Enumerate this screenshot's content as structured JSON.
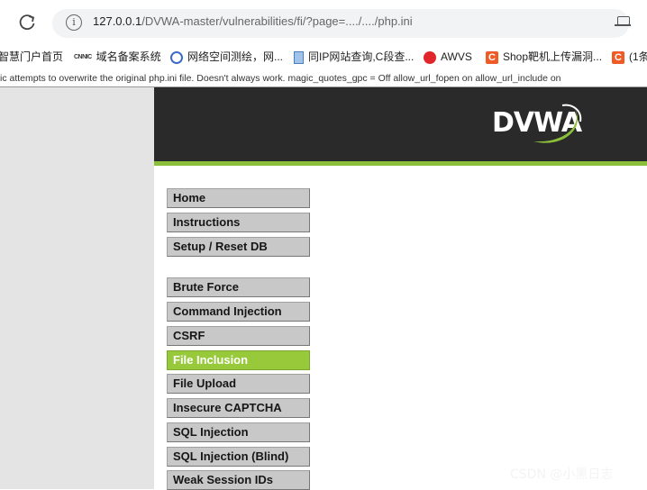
{
  "browser": {
    "url_host": "127.0.0.1",
    "url_path": "/DVWA-master/vulnerabilities/fi/?page=..../..../php.ini",
    "reload_icon": "reload-icon",
    "site_info_icon": "info-icon",
    "tab_icon": "tab-search-icon"
  },
  "bookmarks": [
    {
      "label": "智慧门户首页",
      "icon": "none"
    },
    {
      "label": "域名备案系统",
      "icon": "cnnic-icon",
      "icon_text": "CNNIC"
    },
    {
      "label": "网络空间测绘，网...",
      "icon": "globe-icon"
    },
    {
      "label": "同IP网站查询,C段查...",
      "icon": "document-icon"
    },
    {
      "label": "AWVS",
      "icon": "awvs-icon"
    },
    {
      "label": "Shop靶机上传漏洞...",
      "icon": "csdn-icon",
      "icon_text": "C"
    },
    {
      "label": "(1条",
      "icon": "csdn-icon",
      "icon_text": "C"
    }
  ],
  "warning_text": "ic attempts to overwrite the original php.ini file. Doesn't always work. magic_quotes_gpc = Off allow_url_fopen on allow_url_include on",
  "header": {
    "logo_text": "DVWA",
    "accent_color": "#8bbf3a"
  },
  "menu": {
    "group1": [
      "Home",
      "Instructions",
      "Setup / Reset DB"
    ],
    "group2": [
      "Brute Force",
      "Command Injection",
      "CSRF",
      "File Inclusion",
      "File Upload",
      "Insecure CAPTCHA",
      "SQL Injection",
      "SQL Injection (Blind)",
      "Weak Session IDs"
    ],
    "selected": "File Inclusion"
  },
  "watermark": "CSDN @小黑日志"
}
